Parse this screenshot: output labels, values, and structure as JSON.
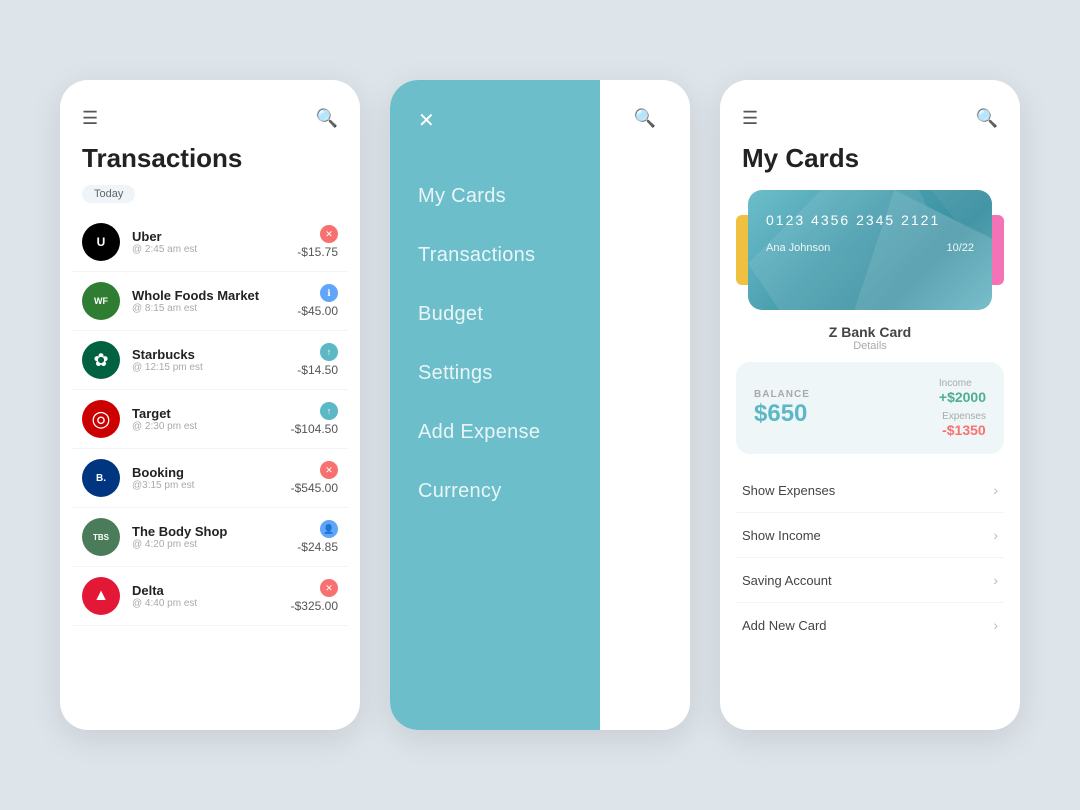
{
  "transactions_screen": {
    "title": "Transactions",
    "today_label": "Today",
    "transactions": [
      {
        "name": "Uber",
        "time": "@ 2:45 am est",
        "amount": "-$15.75",
        "badge_type": "red",
        "logo_type": "uber",
        "logo_text": "U"
      },
      {
        "name": "Whole Foods Market",
        "time": "@ 8:15 am est",
        "amount": "-$45.00",
        "badge_type": "blue",
        "logo_type": "wfm",
        "logo_text": "WF"
      },
      {
        "name": "Starbucks",
        "time": "@ 12:15 pm est",
        "amount": "-$14.50",
        "badge_type": "teal",
        "logo_type": "starbucks",
        "logo_text": "☕"
      },
      {
        "name": "Target",
        "time": "@ 2:30 pm est",
        "amount": "-$104.50",
        "badge_type": "teal",
        "logo_type": "target",
        "logo_text": "🎯"
      },
      {
        "name": "Booking",
        "time": "@3:15 pm est",
        "amount": "-$545.00",
        "badge_type": "red",
        "logo_type": "booking",
        "logo_text": "B"
      },
      {
        "name": "The Body Shop",
        "time": "@ 4:20 pm est",
        "amount": "-$24.85",
        "badge_type": "blue",
        "logo_type": "bodyshop",
        "logo_text": "BS"
      },
      {
        "name": "Delta",
        "time": "@ 4:40 pm est",
        "amount": "-$325.00",
        "badge_type": "red",
        "logo_type": "delta",
        "logo_text": "✈"
      }
    ]
  },
  "menu_screen": {
    "items": [
      {
        "label": "My Cards"
      },
      {
        "label": "Transactions"
      },
      {
        "label": "Budget"
      },
      {
        "label": "Settings"
      },
      {
        "label": "Add Expense"
      },
      {
        "label": "Currency"
      }
    ]
  },
  "mycards_screen": {
    "title": "My Cards",
    "card": {
      "number": "0123  4356  2345  2121",
      "holder_name": "Ana Johnson",
      "expiry": "10/22",
      "bank_name": "Z Bank Card",
      "details_label": "Details"
    },
    "balance": {
      "label": "BALANCE",
      "amount": "$650",
      "income_label": "Income",
      "income_amount": "+$2000",
      "expenses_label": "Expenses",
      "expenses_amount": "-$1350"
    },
    "menu_items": [
      {
        "label": "Show Expenses"
      },
      {
        "label": "Show Income"
      },
      {
        "label": "Saving Account"
      },
      {
        "label": "Add  New Card"
      }
    ]
  }
}
